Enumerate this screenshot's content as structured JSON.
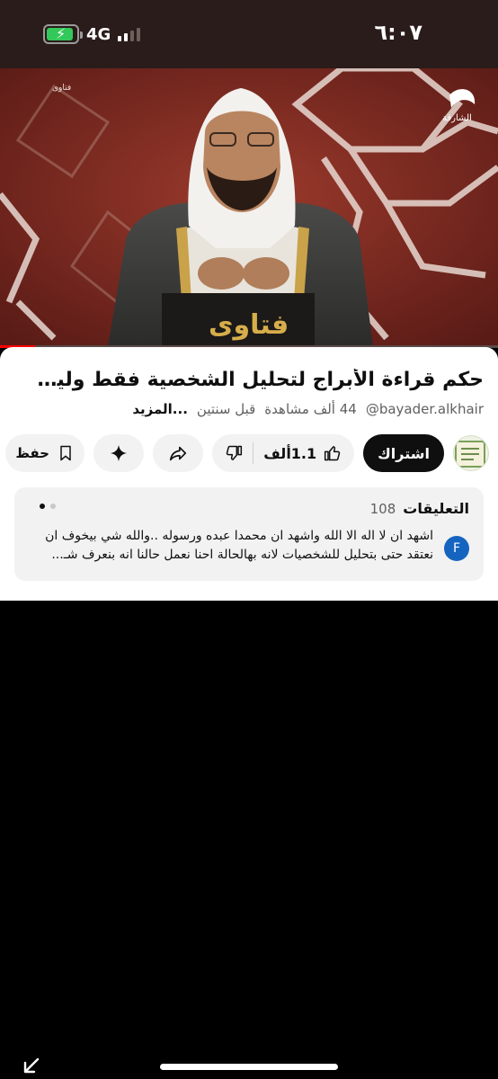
{
  "status_bar": {
    "time": "٦:٠٧",
    "network": "4G",
    "battery_level": 0.9,
    "battery_icon": "battery-charging-icon",
    "signal_bars": 2
  },
  "video": {
    "channel_logo_text": "الشارقة",
    "program_label": "فتاوى",
    "podium_text": "فتاوى",
    "progress": 0.07
  },
  "details": {
    "title": "حكم قراءة الأبراج لتحليل الشخصية فقط وليس لعلم...",
    "handle": "@bayader.alkhair",
    "views": "44 ألف مشاهدة",
    "age": "قبل سنتين",
    "more": "...المزيد"
  },
  "actions": {
    "subscribe": "اشتراك",
    "likes": "1.1ألف",
    "save": "حفظ",
    "icons": [
      "thumbs-up-icon",
      "thumbs-down-icon",
      "share-icon",
      "sparkle-icon",
      "bookmark-icon"
    ]
  },
  "comments": {
    "title": "التعليقات",
    "count": "108",
    "avatar_letter": "F",
    "text": "اشهد ان لا اله الا الله واشهد ان محمدا عبده ورسوله ..والله شي بيخوف ان نعتقد حتى بتحليل للشخصيات لانه بهالحالة احنا نعمل حالنا انه بنعرف شـ...",
    "colors": {
      "avatar": "#1565c0"
    }
  },
  "bottom": {
    "corner_icon": "expand-arrow-icon"
  }
}
